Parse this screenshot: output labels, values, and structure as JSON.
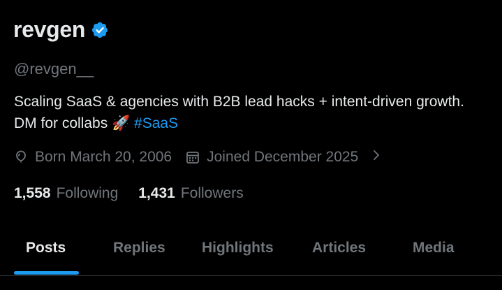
{
  "profile": {
    "name": "revgen",
    "handle": "@revgen__",
    "verified_color": "#1d9bf0",
    "bio_text": "Scaling SaaS & agencies with B2B lead hacks + intent-driven growth. DM for collabs 🚀 ",
    "bio_hashtag": "#SaaS",
    "born": "Born March 20, 2006",
    "joined": "Joined December 2025",
    "following_count": "1,558",
    "following_label": "Following",
    "followers_count": "1,431",
    "followers_label": "Followers"
  },
  "icons": {
    "verified": "verified-badge-icon",
    "born": "balloon-icon",
    "joined": "calendar-icon",
    "more": "chevron-right-icon"
  },
  "tabs": [
    {
      "label": "Posts",
      "active": true
    },
    {
      "label": "Replies",
      "active": false
    },
    {
      "label": "Highlights",
      "active": false
    },
    {
      "label": "Articles",
      "active": false
    },
    {
      "label": "Media",
      "active": false
    }
  ],
  "colors": {
    "background": "#000000",
    "text": "#e7e9ea",
    "secondary": "#71767b",
    "accent": "#1d9bf0"
  }
}
